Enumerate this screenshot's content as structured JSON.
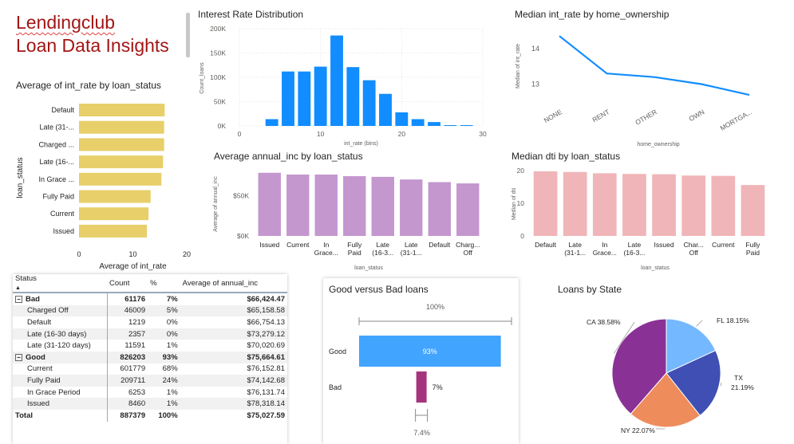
{
  "header": {
    "line1": "Lendingclub",
    "line2": "Loan Data Insights"
  },
  "chart_data": [
    {
      "id": "avg_int_rate_by_status",
      "type": "bar",
      "orientation": "horizontal",
      "title": "Average of int_rate by loan_status",
      "xlabel": "Average of int_rate",
      "ylabel": "loan_status",
      "categories": [
        "Default",
        "Late (31-...",
        "Charged ...",
        "Late (16-...",
        "In Grace ...",
        "Fully Paid",
        "Current",
        "Issued"
      ],
      "values": [
        15.9,
        15.8,
        15.8,
        15.6,
        15.3,
        13.3,
        12.9,
        12.6
      ],
      "xlim": [
        0,
        20
      ],
      "xticks": [
        "0",
        "10",
        "20"
      ],
      "color": "#e8cf6a"
    },
    {
      "id": "int_rate_distribution",
      "type": "bar",
      "title": "Interest Rate Distribution",
      "xlabel": "int_rate (bins)",
      "ylabel": "Count_loans",
      "bin_starts": [
        3,
        4,
        5,
        6,
        7,
        8,
        9,
        10,
        11,
        12,
        13,
        14,
        15,
        16,
        17,
        18,
        19,
        20,
        21,
        22,
        23,
        24,
        25,
        26,
        27,
        28,
        29
      ],
      "values": [
        0,
        0,
        0,
        14000,
        0,
        112000,
        0,
        112000,
        0,
        122000,
        0,
        186000,
        0,
        121000,
        0,
        94000,
        0,
        66000,
        0,
        28000,
        0,
        14000,
        0,
        8000,
        1200,
        900,
        500
      ],
      "bins": [
        {
          "x": 4,
          "value": 14000
        },
        {
          "x": 6,
          "value": 112000
        },
        {
          "x": 8,
          "value": 112000
        },
        {
          "x": 10,
          "value": 122000
        },
        {
          "x": 12,
          "value": 186000
        },
        {
          "x": 14,
          "value": 121000
        },
        {
          "x": 16,
          "value": 94000
        },
        {
          "x": 18,
          "value": 66000
        },
        {
          "x": 20,
          "value": 28000
        },
        {
          "x": 22,
          "value": 14000
        },
        {
          "x": 24,
          "value": 8000
        },
        {
          "x": 26,
          "value": 1200
        },
        {
          "x": 28,
          "value": 900
        }
      ],
      "xlim": [
        0,
        30
      ],
      "ylim": [
        0,
        200000
      ],
      "xticks": [
        "0",
        "10",
        "20",
        "30"
      ],
      "yticks": [
        "0K",
        "50K",
        "100K",
        "150K",
        "200K"
      ],
      "color": "#118dff"
    },
    {
      "id": "median_int_rate_by_home",
      "type": "line",
      "title": "Median int_rate by home_ownership",
      "xlabel": "home_ownership",
      "ylabel": "Median of int_rate",
      "categories": [
        "NONE",
        "RENT",
        "OTHER",
        "OWN",
        "MORTGA..."
      ],
      "values": [
        14.35,
        13.3,
        13.2,
        13.0,
        12.7
      ],
      "ylim": [
        12.5,
        14.6
      ],
      "yticks": [
        "13",
        "14"
      ],
      "color": "#118dff"
    },
    {
      "id": "avg_annual_inc_by_status",
      "type": "bar",
      "title": "Average annual_inc by loan_status",
      "xlabel": "loan_status",
      "ylabel": "Average of annual_inc",
      "categories": [
        "Issued",
        "Current",
        "In Grace...",
        "Fully Paid",
        "Late (16-3...",
        "Late (31-1...",
        "Default",
        "Charg... Off"
      ],
      "values": [
        78318,
        76153,
        76132,
        74143,
        73279,
        70021,
        66754,
        65159
      ],
      "ylim": [
        0,
        85000
      ],
      "yticks": [
        "$0K",
        "$50K"
      ],
      "color": "#c497cf"
    },
    {
      "id": "median_dti_by_status",
      "type": "bar",
      "title": "Median dti by loan_status",
      "xlabel": "loan_status",
      "ylabel": "Median of dti",
      "categories": [
        "Default",
        "Late (31-1...",
        "In Grace...",
        "Late (16-3...",
        "Issued",
        "Char... Off",
        "Current",
        "Fully Paid"
      ],
      "values": [
        19.8,
        19.6,
        19.2,
        19.0,
        18.9,
        18.5,
        18.4,
        15.6
      ],
      "ylim": [
        0,
        21
      ],
      "yticks": [
        "0",
        "10",
        "20"
      ],
      "color": "#f0b5b8"
    },
    {
      "id": "good_vs_bad",
      "type": "bar",
      "orientation": "horizontal",
      "title": "Good versus Bad loans",
      "categories": [
        "Good",
        "Bad"
      ],
      "values": [
        93,
        7
      ],
      "total_label": "100%",
      "labels": [
        "93%",
        "7%",
        "7.4%"
      ],
      "colors": [
        "#41a4ff",
        "#a4357c"
      ]
    },
    {
      "id": "loans_by_state",
      "type": "pie",
      "title": "Loans by State",
      "slices": [
        {
          "label": "FL 18.15%",
          "value": 18.15,
          "color": "#74b9ff"
        },
        {
          "label": "TX 21.19%",
          "value": 21.19,
          "color": "#3f4fb4"
        },
        {
          "label": "NY 22.07%",
          "value": 22.07,
          "color": "#ee8c5c"
        },
        {
          "label": "CA 38.58%",
          "value": 38.58,
          "color": "#8a3196"
        }
      ]
    }
  ],
  "table": {
    "headers": [
      "Status",
      "Count",
      "%",
      "Average of annual_inc"
    ],
    "rows": [
      {
        "kind": "grp",
        "cells": [
          "Bad",
          "61176",
          "7%",
          "$66,424.47"
        ]
      },
      {
        "kind": "sub",
        "cells": [
          "Charged Off",
          "46009",
          "5%",
          "$65,158.58"
        ]
      },
      {
        "kind": "sub",
        "cells": [
          "Default",
          "1219",
          "0%",
          "$66,754.13"
        ]
      },
      {
        "kind": "sub",
        "cells": [
          "Late (16-30 days)",
          "2357",
          "0%",
          "$73,279.12"
        ]
      },
      {
        "kind": "sub",
        "cells": [
          "Late (31-120 days)",
          "11591",
          "1%",
          "$70,020.69"
        ]
      },
      {
        "kind": "grp",
        "cells": [
          "Good",
          "826203",
          "93%",
          "$75,664.61"
        ]
      },
      {
        "kind": "sub",
        "cells": [
          "Current",
          "601779",
          "68%",
          "$76,152.81"
        ]
      },
      {
        "kind": "sub",
        "cells": [
          "Fully Paid",
          "209711",
          "24%",
          "$74,142.68"
        ]
      },
      {
        "kind": "sub",
        "cells": [
          "In Grace Period",
          "6253",
          "1%",
          "$76,131.74"
        ]
      },
      {
        "kind": "sub",
        "cells": [
          "Issued",
          "8460",
          "1%",
          "$78,318.14"
        ]
      },
      {
        "kind": "tot",
        "cells": [
          "Total",
          "887379",
          "100%",
          "$75,027.59"
        ]
      }
    ]
  }
}
